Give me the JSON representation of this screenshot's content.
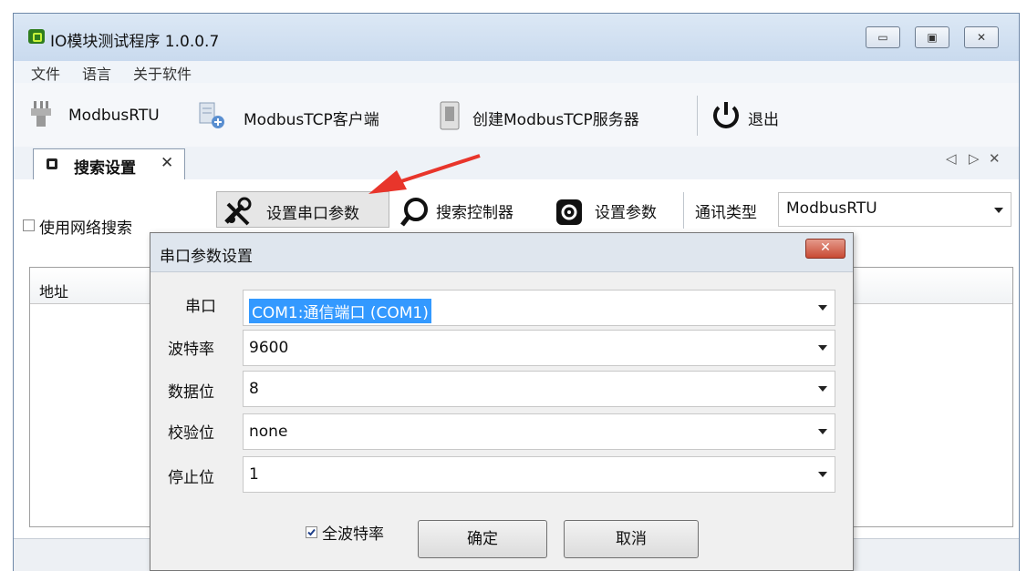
{
  "window": {
    "title": "IO模块测试程序 1.0.0.7",
    "controls": {
      "minimize": "▭",
      "maximize": "▣",
      "close": "✕"
    }
  },
  "menu": [
    "文件",
    "语言",
    "关于软件"
  ],
  "toolbar": {
    "modbus_rtu": "ModbusRTU",
    "modbus_tcp_client": "ModbusTCP客户端",
    "create_tcp_server": "创建ModbusTCP服务器",
    "exit": "退出"
  },
  "tabs": [
    {
      "label": "搜索设置",
      "close": "✕"
    }
  ],
  "tab_nav": {
    "prev": "◁",
    "next": "▷",
    "close": "✕"
  },
  "panel": {
    "use_network_search": {
      "label": "使用网络搜索",
      "checked": false
    },
    "set_serial_params": "设置串口参数",
    "search_controller": "搜索控制器",
    "set_params": "设置参数",
    "comm_type_label": "通讯类型",
    "comm_type_value": "ModbusRTU"
  },
  "table": {
    "headers": [
      "地址"
    ]
  },
  "dialog": {
    "title": "串口参数设置",
    "close": "✕",
    "fields": [
      {
        "label": "串口",
        "value": "COM1:通信端口 (COM1)",
        "selected": true
      },
      {
        "label": "波特率",
        "value": "9600"
      },
      {
        "label": "数据位",
        "value": "8"
      },
      {
        "label": "校验位",
        "value": "none"
      },
      {
        "label": "停止位",
        "value": "1"
      }
    ],
    "all_baud": {
      "label": "全波特率",
      "checked": true
    },
    "ok": "确定",
    "cancel": "取消"
  },
  "colors": {
    "annotation_arrow": "#e8352b",
    "selection": "#3399ff",
    "dialog_close": "#c84a34"
  }
}
